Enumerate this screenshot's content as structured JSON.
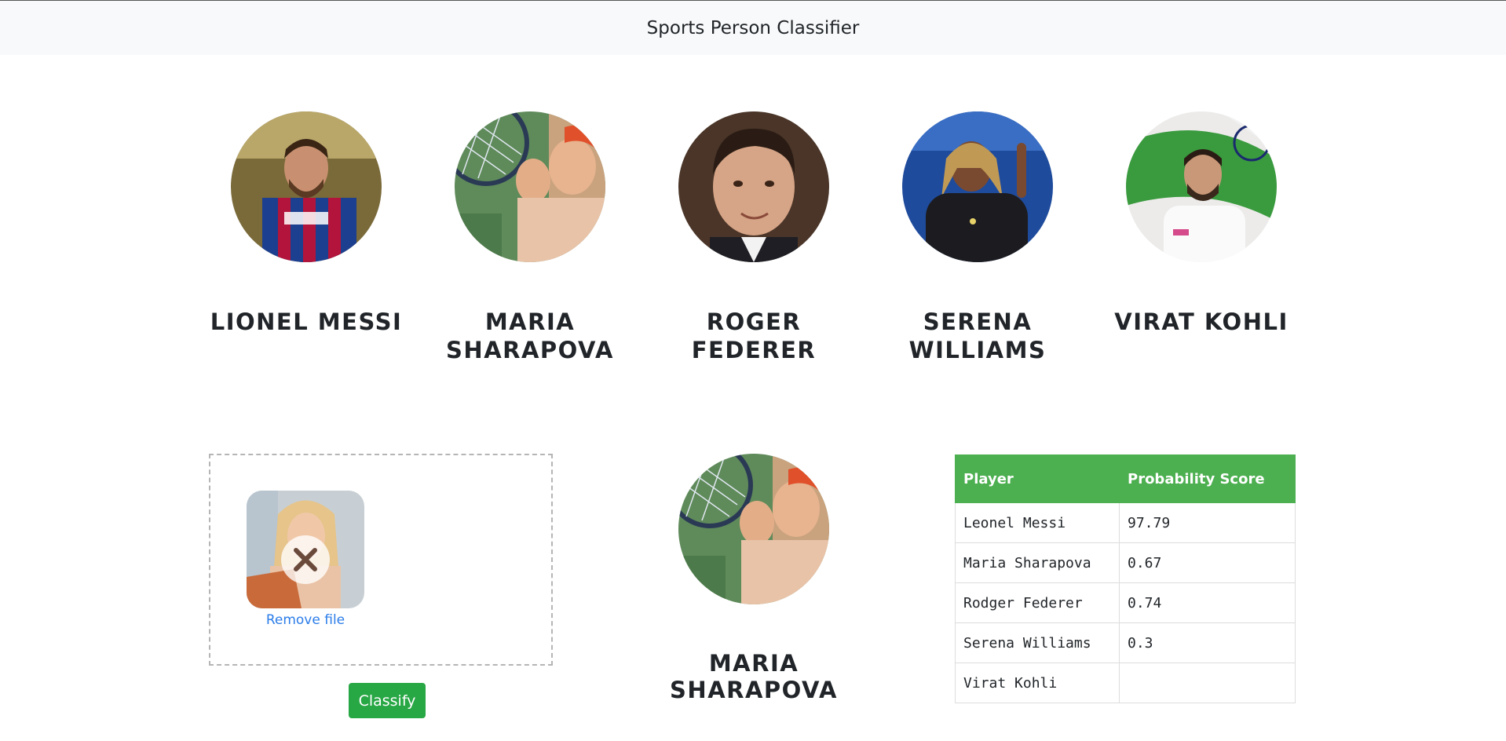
{
  "navbar": {
    "brand": "Sports Person Classifier"
  },
  "players": [
    {
      "name": "Lionel Messi",
      "avatar": "lionel-messi-photo"
    },
    {
      "name": "Maria Sharapova",
      "avatar": "maria-sharapova-photo"
    },
    {
      "name": "Roger Federer",
      "avatar": "roger-federer-photo"
    },
    {
      "name": "Serena Williams",
      "avatar": "serena-williams-photo"
    },
    {
      "name": "Virat Kohli",
      "avatar": "virat-kohli-photo"
    }
  ],
  "upload": {
    "remove_label": "Remove file",
    "remove_icon": "remove-x-icon"
  },
  "classify_button": "Classify",
  "result": {
    "name": "Maria Sharapova"
  },
  "scores_table": {
    "headers": [
      "Player",
      "Probability Score"
    ],
    "rows": [
      {
        "player": "Leonel Messi",
        "score": "97.79"
      },
      {
        "player": "Maria Sharapova",
        "score": "0.67"
      },
      {
        "player": "Rodger Federer",
        "score": "0.74"
      },
      {
        "player": "Serena Williams",
        "score": "0.3"
      },
      {
        "player": "Virat Kohli",
        "score": ""
      }
    ]
  },
  "colors": {
    "header_green": "#4caf50",
    "button_green": "#28a745",
    "link_blue": "#2b7de9"
  }
}
